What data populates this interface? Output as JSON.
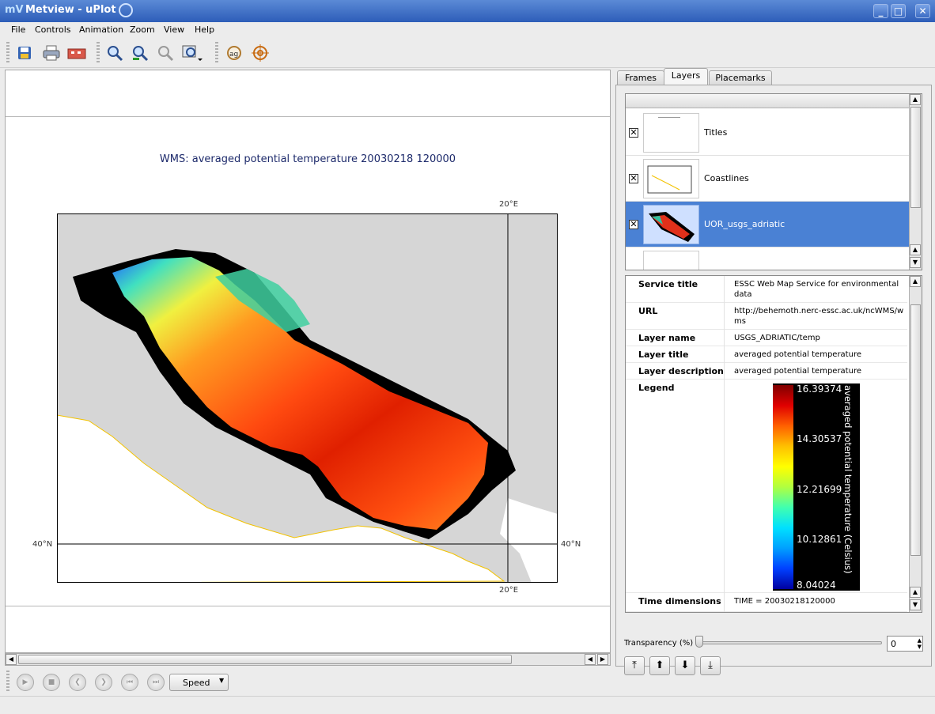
{
  "window": {
    "title": "Metview - uPlot"
  },
  "menu": [
    "File",
    "Controls",
    "Animation",
    "Zoom",
    "View",
    "Help"
  ],
  "toolbar": {
    "icons": [
      "save-icon",
      "print-icon",
      "export-icon",
      "zoom-icon",
      "zoom-in-icon",
      "zoom-out-icon",
      "zoom-history-icon",
      "magnifier-icon",
      "cursor-data-icon"
    ]
  },
  "plot": {
    "title": "WMS: averaged potential temperature 20030218 120000",
    "lon_top": "20°E",
    "lon_bottom": "20°E",
    "lat_left": "40°N",
    "lat_right": "40°N",
    "colors": {
      "sea": "#d6d6d6",
      "land": "#ffffff",
      "coast": "#f2c200"
    }
  },
  "player": {
    "speed_label": "Speed"
  },
  "tabs": [
    "Frames",
    "Layers",
    "Placemarks"
  ],
  "active_tab": "Layers",
  "layers": [
    {
      "name": "Titles",
      "checked": true,
      "selected": false
    },
    {
      "name": "Coastlines",
      "checked": true,
      "selected": false
    },
    {
      "name": "UOR_usgs_adriatic",
      "checked": true,
      "selected": true
    }
  ],
  "info": {
    "service_title_key": "Service title",
    "service_title": "ESSC Web Map Service for environmental data",
    "url_key": "URL",
    "url": "http://behemoth.nerc-essc.ac.uk/ncWMS/wms",
    "layer_name_key": "Layer name",
    "layer_name": "USGS_ADRIATIC/temp",
    "layer_title_key": "Layer title",
    "layer_title": "averaged potential temperature",
    "layer_desc_key": "Layer description",
    "layer_desc": "averaged potential temperature",
    "legend_key": "Legend",
    "time_key": "Time dimensions",
    "time": "TIME = 20030218120000"
  },
  "legend": {
    "title": "averaged potential temperature (Celsius)",
    "ticks": [
      "16.39374",
      "14.30537",
      "12.21699",
      "10.12861",
      "8.04024"
    ]
  },
  "transparency": {
    "label": "Transparency (%)",
    "value": "0",
    "level_pct": 0
  }
}
